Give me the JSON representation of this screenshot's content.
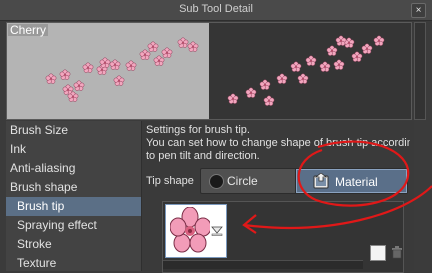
{
  "window": {
    "title": "Sub Tool Detail",
    "close_glyph": "×"
  },
  "preview": {
    "label": "Cherry"
  },
  "sidebar": {
    "items": [
      {
        "label": "Brush Size"
      },
      {
        "label": "Ink"
      },
      {
        "label": "Anti-aliasing"
      },
      {
        "label": "Brush shape"
      },
      {
        "label": "Brush tip",
        "selected": true
      },
      {
        "label": "Spraying effect"
      },
      {
        "label": "Stroke"
      },
      {
        "label": "Texture"
      }
    ]
  },
  "main": {
    "description_line1": "Settings for brush tip.",
    "description_line2": "You can set how to change shape of brush tip according",
    "description_line3": "to pen tilt and direction.",
    "tip_shape_label": "Tip shape",
    "circle_label": "Circle",
    "material_label": "Material"
  },
  "icons": {
    "close": "close-icon",
    "circle_shape": "circle-icon",
    "material": "material-icon",
    "dropdown": "dropdown-arrow-icon",
    "new": "new-page-icon",
    "trash": "trash-icon"
  },
  "colors": {
    "selection": "#5b6f86",
    "annotation": "#e01818",
    "blossom": "#f2a6be"
  }
}
